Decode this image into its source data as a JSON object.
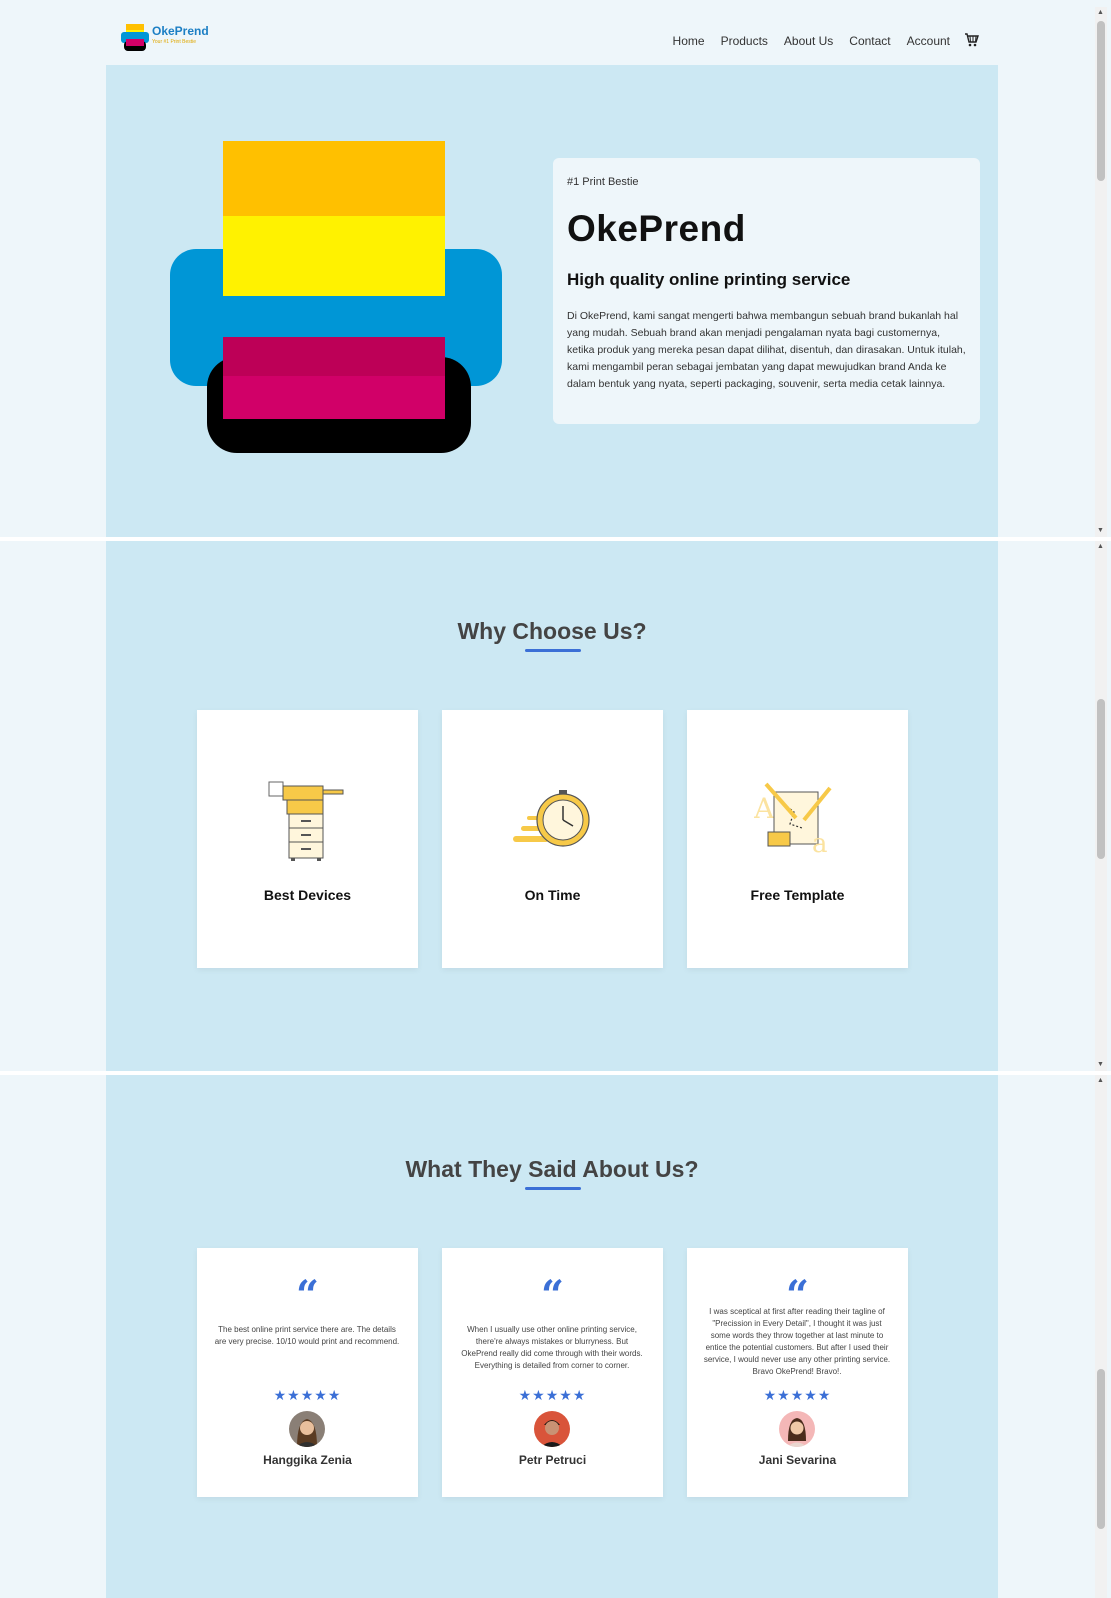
{
  "nav": {
    "logo_name": "OkePrend",
    "logo_tagline": "Your #1 Print Bestie",
    "links": [
      "Home",
      "Products",
      "About Us",
      "Contact",
      "Account"
    ],
    "cart_icon": "cart-icon"
  },
  "hero": {
    "tag": "#1 Print Bestie",
    "title": "OkePrend",
    "subtitle": "High quality online printing service",
    "description": "Di OkePrend, kami sangat mengerti bahwa membangun sebuah brand bukanlah hal yang mudah. Sebuah brand akan menjadi pengalaman nyata bagi customernya, ketika produk yang mereka pesan dapat dilihat, disentuh, dan dirasakan. Untuk itulah, kami mengambil peran sebagai jembatan yang dapat mewujudkan brand Anda ke dalam bentuk yang nyata, seperti packaging, souvenir, serta media cetak lainnya.",
    "colors": {
      "band": "#cce8f3",
      "printer_blue": "#0096d6",
      "paper_orange": "#ffc000",
      "paper_yellow": "#fff200",
      "paper_magenta": "#d10068",
      "printer_black": "#000000"
    }
  },
  "why": {
    "title": "Why Choose Us?",
    "cards": [
      {
        "title": "Best Devices",
        "icon": "copier-icon"
      },
      {
        "title": "On Time",
        "icon": "fast-clock-icon"
      },
      {
        "title": "Free Template",
        "icon": "design-template-icon"
      }
    ]
  },
  "testimonials": {
    "title": "What They Said About Us?",
    "reviews": [
      {
        "text": "The best online print service there are. The details are very precise. 10/10 would print and recommend.",
        "stars": "★★★★★",
        "name": "Hanggika Zenia"
      },
      {
        "text": "When I usually use other online printing service, there're always mistakes or blurryness. But OkePrend really did come through with their words. Everything is detailed from corner to corner.",
        "stars": "★★★★★",
        "name": "Petr Petruci"
      },
      {
        "text": "I was sceptical at first after reading their tagline of \"Precission in Every Detail\", I thought it was just some words they throw together at last minute to entice the potential customers. But after I used their service, I would never use any other printing service. Bravo OkePrend! Bravo!.",
        "stars": "★★★★★",
        "name": "Jani Sevarina"
      }
    ]
  },
  "accent_color": "#3b6fd6"
}
